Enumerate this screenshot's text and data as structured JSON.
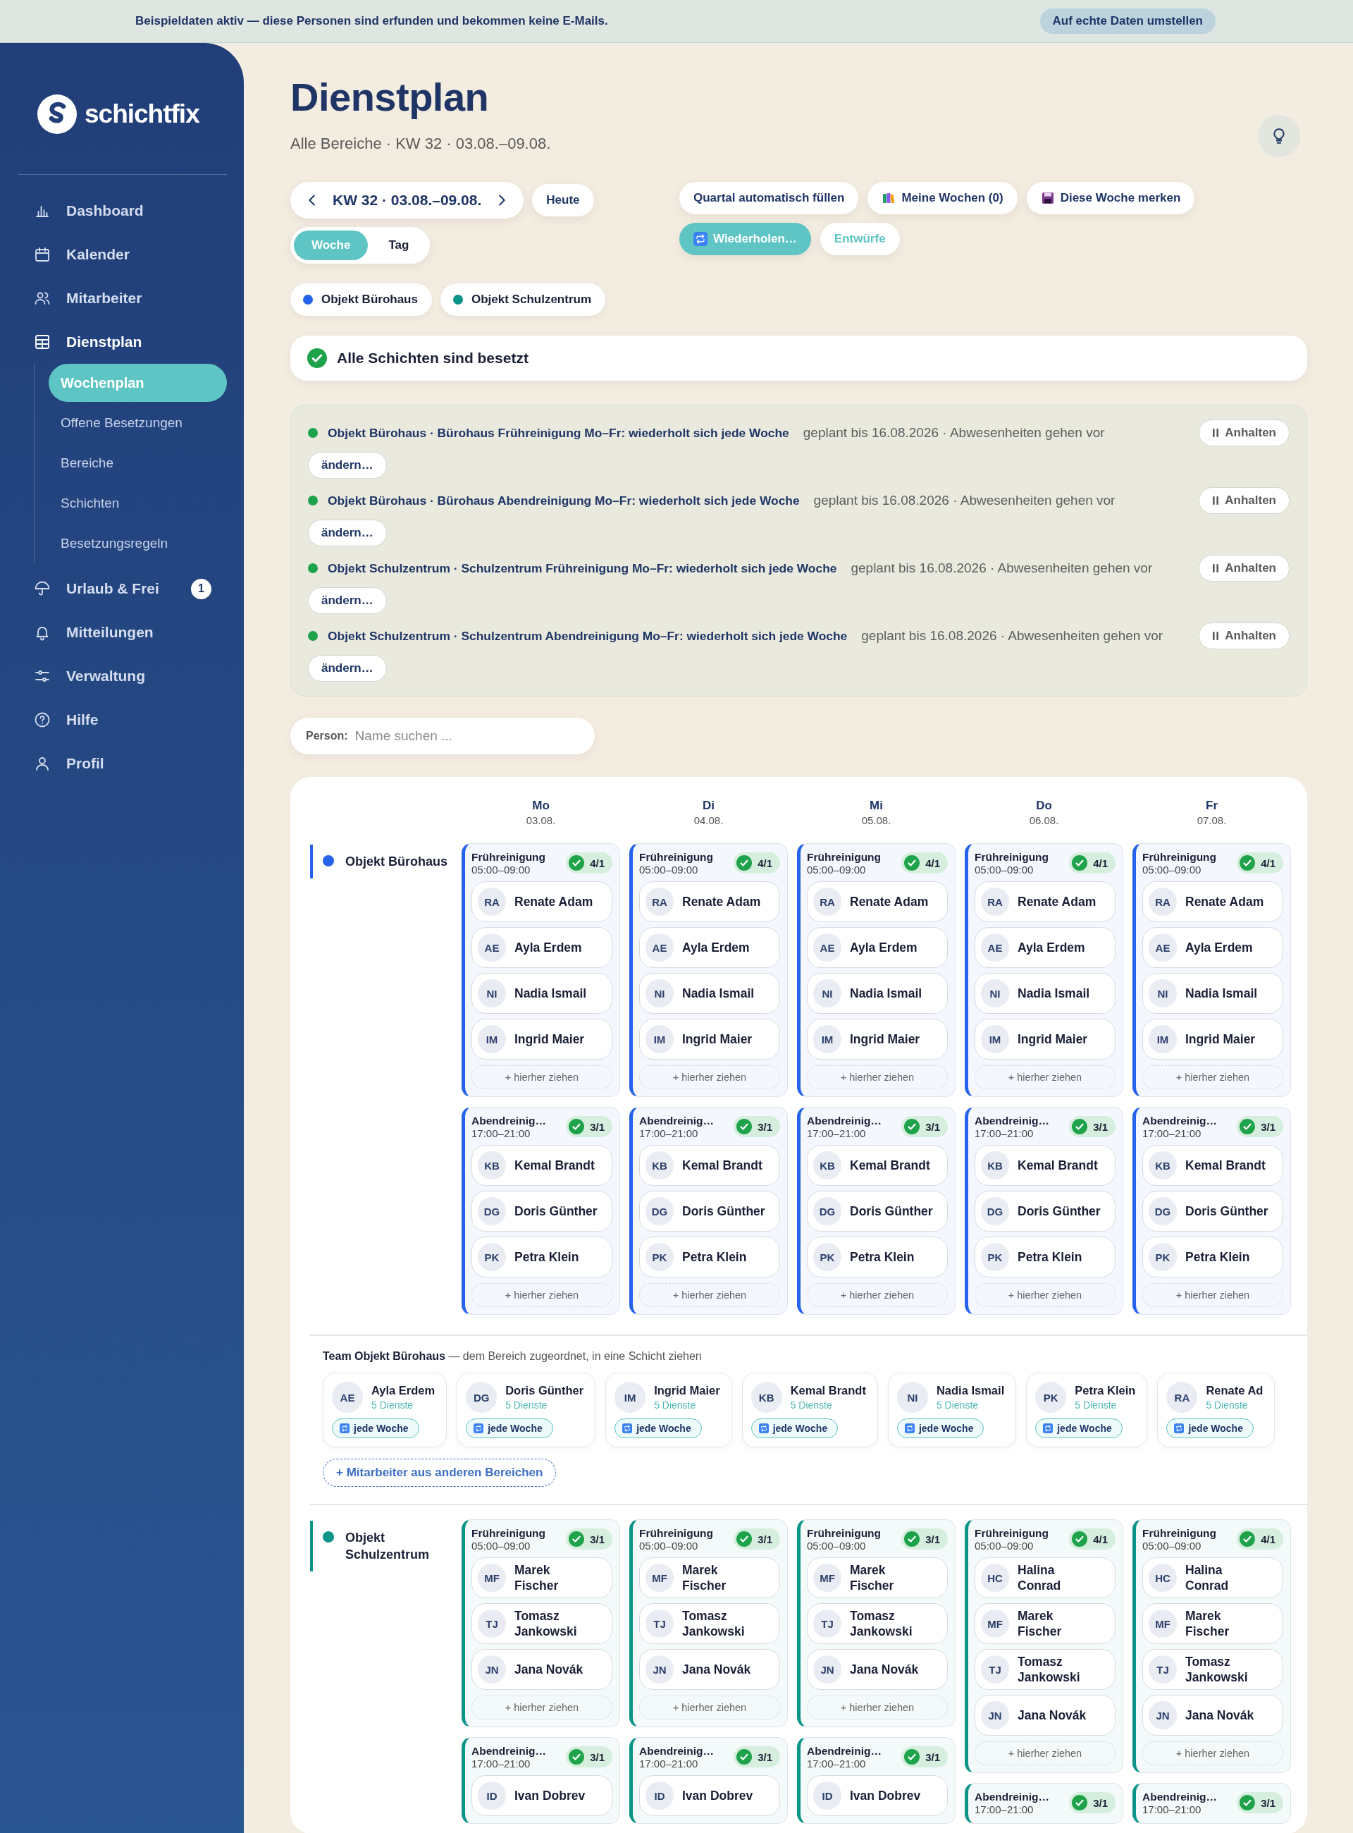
{
  "banner": {
    "text": "Beispieldaten aktiv — diese Personen sind erfunden und bekommen keine E-Mails.",
    "button": "Auf echte Daten umstellen"
  },
  "sidebar": {
    "brand": "schichtfix",
    "items": [
      {
        "label": "Dashboard",
        "selected": false
      },
      {
        "label": "Kalender",
        "selected": false
      },
      {
        "label": "Mitarbeiter",
        "selected": false
      },
      {
        "label": "Dienstplan",
        "selected": true,
        "children": [
          {
            "label": "Wochenplan",
            "selected": true
          },
          {
            "label": "Offene Besetzungen",
            "selected": false
          },
          {
            "label": "Bereiche",
            "selected": false
          },
          {
            "label": "Schichten",
            "selected": false
          },
          {
            "label": "Besetzungsregeln",
            "selected": false
          }
        ]
      },
      {
        "label": "Urlaub & Frei",
        "selected": false,
        "badge": "1"
      },
      {
        "label": "Mitteilungen",
        "selected": false
      },
      {
        "label": "Verwaltung",
        "selected": false
      },
      {
        "label": "Hilfe",
        "selected": false
      },
      {
        "label": "Profil",
        "selected": false
      }
    ]
  },
  "header": {
    "title": "Dienstplan",
    "subtitle": "Alle Bereiche · KW 32 · 03.08.–09.08."
  },
  "toolbar": {
    "week": "KW 32 · 03.08.–09.08.",
    "today": "Heute",
    "views": [
      {
        "label": "Woche",
        "selected": true
      },
      {
        "label": "Tag",
        "selected": false
      }
    ],
    "actions": [
      {
        "label": "Quartal automatisch füllen",
        "kind": "plain"
      },
      {
        "label": "Meine Wochen (0)",
        "kind": "books"
      },
      {
        "label": "Diese Woche merken",
        "kind": "save"
      },
      {
        "label": "Wiederholen…",
        "kind": "repeat"
      },
      {
        "label": "Entwürfe",
        "kind": "draft"
      }
    ]
  },
  "area_filters": [
    {
      "label": "Objekt Bürohaus",
      "color": "#2563eb"
    },
    {
      "label": "Objekt Schulzentrum",
      "color": "#0d9488"
    }
  ],
  "status": {
    "text": "Alle Schichten sind besetzt",
    "all_filled": true
  },
  "rules": [
    {
      "title": "Objekt Bürohaus · Bürohaus Frühreinigung Mo–Fr: wiederholt sich jede Woche",
      "meta": "geplant bis 16.08.2026 · Abwesenheiten gehen vor",
      "active": true,
      "pause": "Anhalten",
      "edit": "ändern…"
    },
    {
      "title": "Objekt Bürohaus · Bürohaus Abendreinigung Mo–Fr: wiederholt sich jede Woche",
      "meta": "geplant bis 16.08.2026 · Abwesenheiten gehen vor",
      "active": true,
      "pause": "Anhalten",
      "edit": "ändern…"
    },
    {
      "title": "Objekt Schulzentrum · Schulzentrum Frühreinigung Mo–Fr: wiederholt sich jede Woche",
      "meta": "geplant bis 16.08.2026 · Abwesenheiten gehen vor",
      "active": true,
      "pause": "Anhalten",
      "edit": "ändern…"
    },
    {
      "title": "Objekt Schulzentrum · Schulzentrum Abendreinigung Mo–Fr: wiederholt sich jede Woche",
      "meta": "geplant bis 16.08.2026 · Abwesenheiten gehen vor",
      "active": true,
      "pause": "Anhalten",
      "edit": "ändern…"
    }
  ],
  "person_search": {
    "label": "Person:",
    "placeholder": "Name suchen ..."
  },
  "schedule": {
    "days": [
      {
        "name": "Mo",
        "date": "03.08."
      },
      {
        "name": "Di",
        "date": "04.08."
      },
      {
        "name": "Mi",
        "date": "05.08."
      },
      {
        "name": "Do",
        "date": "06.08."
      },
      {
        "name": "Fr",
        "date": "07.08."
      }
    ],
    "areas": [
      {
        "name": "Objekt Bürohaus",
        "color": "#2563eb",
        "rows": [
          {
            "cells": [
              {
                "title": "Frühreinigung",
                "time": "05:00–09:00",
                "count": "4/1",
                "covered": true,
                "people": [
                  {
                    "initials": "RA",
                    "name": "Renate Adam"
                  },
                  {
                    "initials": "AE",
                    "name": "Ayla Erdem"
                  },
                  {
                    "initials": "NI",
                    "name": "Nadia Ismail"
                  },
                  {
                    "initials": "IM",
                    "name": "Ingrid Maier"
                  }
                ],
                "drop": "+ hierher ziehen"
              },
              {
                "title": "Frühreinigung",
                "time": "05:00–09:00",
                "count": "4/1",
                "covered": true,
                "people": [
                  {
                    "initials": "RA",
                    "name": "Renate Adam"
                  },
                  {
                    "initials": "AE",
                    "name": "Ayla Erdem"
                  },
                  {
                    "initials": "NI",
                    "name": "Nadia Ismail"
                  },
                  {
                    "initials": "IM",
                    "name": "Ingrid Maier"
                  }
                ],
                "drop": "+ hierher ziehen"
              },
              {
                "title": "Frühreinigung",
                "time": "05:00–09:00",
                "count": "4/1",
                "covered": true,
                "people": [
                  {
                    "initials": "RA",
                    "name": "Renate Adam"
                  },
                  {
                    "initials": "AE",
                    "name": "Ayla Erdem"
                  },
                  {
                    "initials": "NI",
                    "name": "Nadia Ismail"
                  },
                  {
                    "initials": "IM",
                    "name": "Ingrid Maier"
                  }
                ],
                "drop": "+ hierher ziehen"
              },
              {
                "title": "Frühreinigung",
                "time": "05:00–09:00",
                "count": "4/1",
                "covered": true,
                "people": [
                  {
                    "initials": "RA",
                    "name": "Renate Adam"
                  },
                  {
                    "initials": "AE",
                    "name": "Ayla Erdem"
                  },
                  {
                    "initials": "NI",
                    "name": "Nadia Ismail"
                  },
                  {
                    "initials": "IM",
                    "name": "Ingrid Maier"
                  }
                ],
                "drop": "+ hierher ziehen"
              },
              {
                "title": "Frühreinigung",
                "time": "05:00–09:00",
                "count": "4/1",
                "covered": true,
                "people": [
                  {
                    "initials": "RA",
                    "name": "Renate Adam"
                  },
                  {
                    "initials": "AE",
                    "name": "Ayla Erdem"
                  },
                  {
                    "initials": "NI",
                    "name": "Nadia Ismail"
                  },
                  {
                    "initials": "IM",
                    "name": "Ingrid Maier"
                  }
                ],
                "drop": "+ hierher ziehen"
              }
            ]
          },
          {
            "cells": [
              {
                "title": "Abendreinig…",
                "time": "17:00–21:00",
                "count": "3/1",
                "covered": true,
                "people": [
                  {
                    "initials": "KB",
                    "name": "Kemal Brandt"
                  },
                  {
                    "initials": "DG",
                    "name": "Doris Günther"
                  },
                  {
                    "initials": "PK",
                    "name": "Petra Klein"
                  }
                ],
                "drop": "+ hierher ziehen"
              },
              {
                "title": "Abendreinig…",
                "time": "17:00–21:00",
                "count": "3/1",
                "covered": true,
                "people": [
                  {
                    "initials": "KB",
                    "name": "Kemal Brandt"
                  },
                  {
                    "initials": "DG",
                    "name": "Doris Günther"
                  },
                  {
                    "initials": "PK",
                    "name": "Petra Klein"
                  }
                ],
                "drop": "+ hierher ziehen"
              },
              {
                "title": "Abendreinig…",
                "time": "17:00–21:00",
                "count": "3/1",
                "covered": true,
                "people": [
                  {
                    "initials": "KB",
                    "name": "Kemal Brandt"
                  },
                  {
                    "initials": "DG",
                    "name": "Doris Günther"
                  },
                  {
                    "initials": "PK",
                    "name": "Petra Klein"
                  }
                ],
                "drop": "+ hierher ziehen"
              },
              {
                "title": "Abendreinig…",
                "time": "17:00–21:00",
                "count": "3/1",
                "covered": true,
                "people": [
                  {
                    "initials": "KB",
                    "name": "Kemal Brandt"
                  },
                  {
                    "initials": "DG",
                    "name": "Doris Günther"
                  },
                  {
                    "initials": "PK",
                    "name": "Petra Klein"
                  }
                ],
                "drop": "+ hierher ziehen"
              },
              {
                "title": "Abendreinig…",
                "time": "17:00–21:00",
                "count": "3/1",
                "covered": true,
                "people": [
                  {
                    "initials": "KB",
                    "name": "Kemal Brandt"
                  },
                  {
                    "initials": "DG",
                    "name": "Doris Günther"
                  },
                  {
                    "initials": "PK",
                    "name": "Petra Klein"
                  }
                ],
                "drop": "+ hierher ziehen"
              }
            ]
          }
        ],
        "team": {
          "title": "Team Objekt Bürohaus",
          "note": "— dem Bereich zugeordnet, in eine Schicht ziehen",
          "members": [
            {
              "initials": "AE",
              "name": "Ayla Erdem",
              "shifts": "5 Dienste",
              "tag": "jede Woche"
            },
            {
              "initials": "DG",
              "name": "Doris Günther",
              "shifts": "5 Dienste",
              "tag": "jede Woche"
            },
            {
              "initials": "IM",
              "name": "Ingrid Maier",
              "shifts": "5 Dienste",
              "tag": "jede Woche"
            },
            {
              "initials": "KB",
              "name": "Kemal Brandt",
              "shifts": "5 Dienste",
              "tag": "jede Woche"
            },
            {
              "initials": "NI",
              "name": "Nadia Ismail",
              "shifts": "5 Dienste",
              "tag": "jede Woche"
            },
            {
              "initials": "PK",
              "name": "Petra Klein",
              "shifts": "5 Dienste",
              "tag": "jede Woche"
            },
            {
              "initials": "RA",
              "name": "Renate Ad",
              "shifts": "5 Dienste",
              "tag": "jede Woche"
            }
          ],
          "add": "+ Mitarbeiter aus anderen Bereichen"
        }
      },
      {
        "name": "Objekt Schulzentrum",
        "color": "#0d9488",
        "rows": [
          {
            "cells": [
              {
                "title": "Frühreinigung",
                "time": "05:00–09:00",
                "count": "3/1",
                "covered": true,
                "people": [
                  {
                    "initials": "MF",
                    "name": "Marek Fischer"
                  },
                  {
                    "initials": "TJ",
                    "name": "Tomasz Jankowski"
                  },
                  {
                    "initials": "JN",
                    "name": "Jana Novák"
                  }
                ],
                "drop": "+ hierher ziehen"
              },
              {
                "title": "Frühreinigung",
                "time": "05:00–09:00",
                "count": "3/1",
                "covered": true,
                "people": [
                  {
                    "initials": "MF",
                    "name": "Marek Fischer"
                  },
                  {
                    "initials": "TJ",
                    "name": "Tomasz Jankowski"
                  },
                  {
                    "initials": "JN",
                    "name": "Jana Novák"
                  }
                ],
                "drop": "+ hierher ziehen"
              },
              {
                "title": "Frühreinigung",
                "time": "05:00–09:00",
                "count": "3/1",
                "covered": true,
                "people": [
                  {
                    "initials": "MF",
                    "name": "Marek Fischer"
                  },
                  {
                    "initials": "TJ",
                    "name": "Tomasz Jankowski"
                  },
                  {
                    "initials": "JN",
                    "name": "Jana Novák"
                  }
                ],
                "drop": "+ hierher ziehen"
              },
              {
                "title": "Frühreinigung",
                "time": "05:00–09:00",
                "count": "4/1",
                "covered": true,
                "people": [
                  {
                    "initials": "HC",
                    "name": "Halina Conrad"
                  },
                  {
                    "initials": "MF",
                    "name": "Marek Fischer"
                  },
                  {
                    "initials": "TJ",
                    "name": "Tomasz Jankowski"
                  },
                  {
                    "initials": "JN",
                    "name": "Jana Novák"
                  }
                ],
                "drop": "+ hierher ziehen"
              },
              {
                "title": "Frühreinigung",
                "time": "05:00–09:00",
                "count": "4/1",
                "covered": true,
                "people": [
                  {
                    "initials": "HC",
                    "name": "Halina Conrad"
                  },
                  {
                    "initials": "MF",
                    "name": "Marek Fischer"
                  },
                  {
                    "initials": "TJ",
                    "name": "Tomasz Jankowski"
                  },
                  {
                    "initials": "JN",
                    "name": "Jana Novák"
                  }
                ],
                "drop": "+ hierher ziehen"
              }
            ]
          },
          {
            "cells": [
              {
                "title": "Abendreinig…",
                "time": "17:00–21:00",
                "count": "3/1",
                "covered": true,
                "people": [
                  {
                    "initials": "ID",
                    "name": "Ivan Dobrev"
                  }
                ]
              },
              {
                "title": "Abendreinig…",
                "time": "17:00–21:00",
                "count": "3/1",
                "covered": true,
                "people": [
                  {
                    "initials": "ID",
                    "name": "Ivan Dobrev"
                  }
                ]
              },
              {
                "title": "Abendreinig…",
                "time": "17:00–21:00",
                "count": "3/1",
                "covered": true,
                "people": [
                  {
                    "initials": "ID",
                    "name": "Ivan Dobrev"
                  }
                ]
              },
              {
                "title": "Abendreinig…",
                "time": "17:00–21:00",
                "count": "3/1",
                "covered": true
              },
              {
                "title": "Abendreinig…",
                "time": "17:00–21:00",
                "count": "3/1",
                "covered": true
              }
            ]
          }
        ]
      }
    ]
  }
}
